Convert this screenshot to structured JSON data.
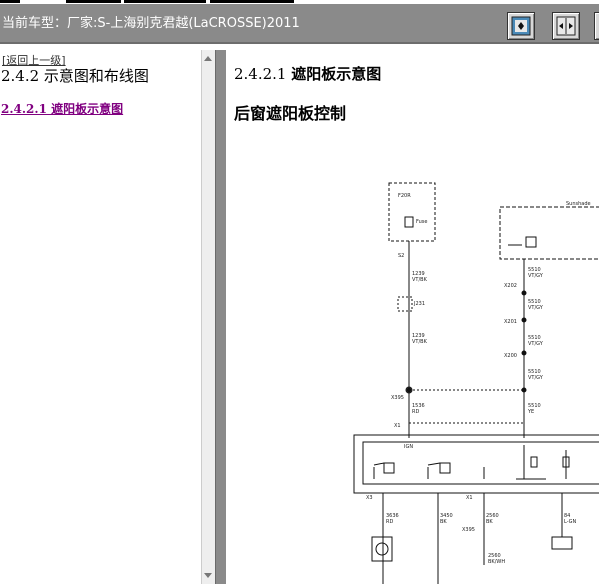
{
  "header": {
    "title": "当前车型：厂家:S-上海别克君越(LaCROSSE)2011",
    "buttons": [
      "layout-single-icon",
      "layout-split-icon",
      "layout-extra-icon"
    ]
  },
  "left_pane": {
    "back_link": "[返回上一级]",
    "section_title": "2.4.2 示意图和布线图",
    "links": [
      {
        "label": "2.4.2.1 遮阳板示意图"
      }
    ]
  },
  "right_pane": {
    "number": "2.4.2.1",
    "title": "遮阳板示意图",
    "subtitle": "后窗遮阳板控制"
  },
  "colors": {
    "header_bg": "#8a8a8a",
    "link_visited": "#800080"
  }
}
